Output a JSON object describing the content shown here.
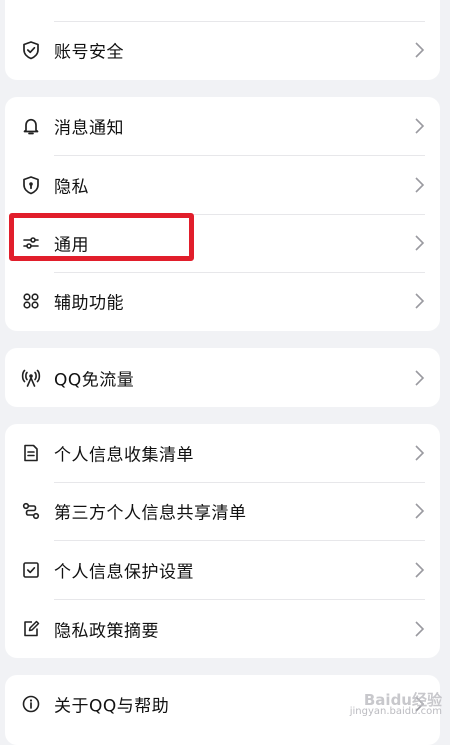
{
  "settings": {
    "group0": [
      {
        "label": "账号安全",
        "icon": "shield-check-icon"
      }
    ],
    "group1": [
      {
        "label": "消息通知",
        "icon": "bell-icon"
      },
      {
        "label": "隐私",
        "icon": "shield-lock-icon"
      },
      {
        "label": "通用",
        "icon": "sliders-icon"
      },
      {
        "label": "辅助功能",
        "icon": "grid-icon"
      }
    ],
    "group2": [
      {
        "label": "QQ免流量",
        "icon": "signal-tower-icon"
      }
    ],
    "group3": [
      {
        "label": "个人信息收集清单",
        "icon": "document-list-icon"
      },
      {
        "label": "第三方个人信息共享清单",
        "icon": "share-flow-icon"
      },
      {
        "label": "个人信息保护设置",
        "icon": "checkbox-icon"
      },
      {
        "label": "隐私政策摘要",
        "icon": "edit-icon"
      }
    ],
    "group4": [
      {
        "label": "关于QQ与帮助",
        "icon": "info-icon"
      }
    ]
  },
  "annotation": {
    "highlighted_item": "通用",
    "color": "#e11e2b"
  },
  "watermark": {
    "brand": "Baidu经验",
    "url": "jingyan.baidu.com"
  }
}
